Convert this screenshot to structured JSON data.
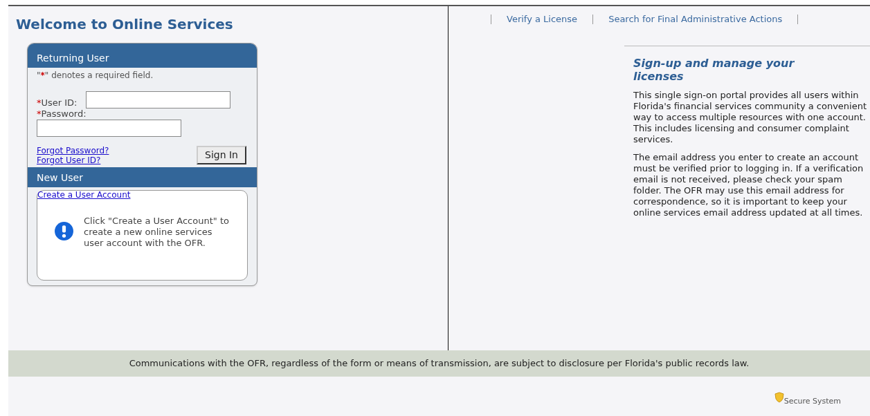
{
  "title": "Welcome to Online Services",
  "returning_user": {
    "heading": "Returning User",
    "note": {
      "before": "\"",
      "mark": "*",
      "after": "\" denotes a required field."
    },
    "fields": [
      {
        "label": "User ID:",
        "mark": "*",
        "kind": "inline"
      },
      {
        "label": "Password:",
        "mark": "*",
        "kind": "stacked"
      }
    ],
    "links": [
      "Forgot Password?",
      "Forgot User ID?"
    ],
    "button": "Sign In"
  },
  "new_user": {
    "heading": "New User",
    "link": "Create a User Account",
    "info": "Click \"Create a User Account\" to create a new online services user account with the OFR."
  },
  "nav_links": [
    "Verify a License",
    "Search for Final Administrative Actions"
  ],
  "aside": {
    "heading": "Sign-up and manage your licenses",
    "paragraphs": [
      "This single sign-on portal provides all users within Florida's financial services community a convenient way to access multiple resources with one account. This includes licensing and consumer complaint services.",
      "The email address you enter to create an account must be verified prior to logging in. If a verification email is not received, please check your spam folder. The OFR may use this email address for correspondence, so it is important to keep your online services email address updated at all times."
    ]
  },
  "footer": "Communications with the OFR, regardless of the form or means of transmission, are subject to disclosure per Florida's public records law.",
  "secure_label": "Secure System"
}
